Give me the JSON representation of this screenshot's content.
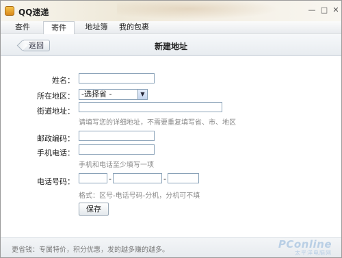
{
  "window": {
    "title": "QQ速递"
  },
  "tabs": [
    {
      "label": "查件"
    },
    {
      "label": "寄件",
      "active": true
    },
    {
      "label": "地址簿"
    },
    {
      "label": "我的包裹"
    }
  ],
  "header": {
    "back_label": "返回",
    "title": "新建地址"
  },
  "form": {
    "name_label": "姓名：",
    "region_label": "所在地区：",
    "region_select": "-选择省 -",
    "street_label": "街道地址：",
    "street_hint": "请填写您的详细地址，不需要重复填写省、市、地区",
    "zip_label": "邮政编码：",
    "mobile_label": "手机电话：",
    "mobile_hint": "手机和电话至少填写一项",
    "phone_label": "电话号码：",
    "phone_sep": "-",
    "phone_hint": "格式：区号-电话号码-分机，分机可不填",
    "save_label": "保存"
  },
  "footer": {
    "text": "更省钱：专属特价，积分优惠，发的越多赚的越多。"
  },
  "watermark": {
    "main": "PConline",
    "sub": "太平洋电脑网"
  },
  "colors": {
    "input_border": "#8aa2b8",
    "hint": "#8a8a8a",
    "watermark": "#b9cfe5"
  }
}
